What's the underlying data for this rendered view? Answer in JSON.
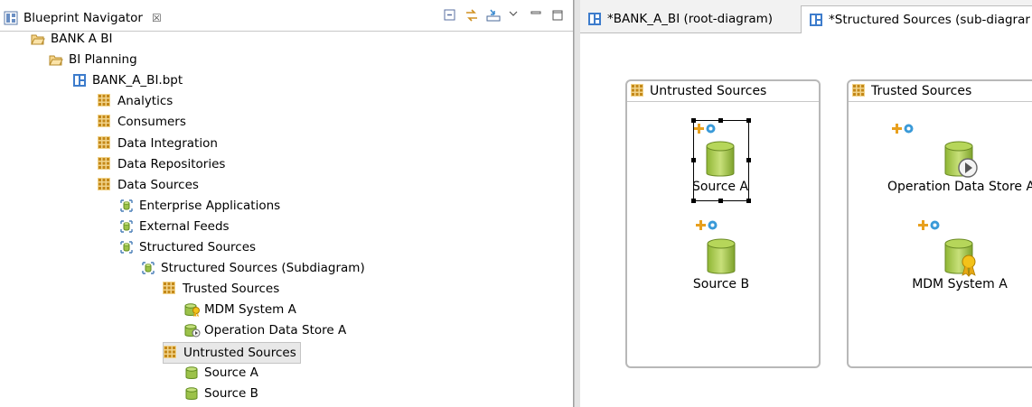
{
  "navigator": {
    "title": "Blueprint Navigator",
    "close_glyph": "☒",
    "tools": [
      "collapse-all-icon",
      "link-with-editor-icon",
      "import-icon",
      "view-menu-icon",
      "minimize-icon",
      "maximize-icon"
    ],
    "tree": [
      {
        "label": "BANK A BI",
        "icon": "folder-open-icon",
        "level": 0
      },
      {
        "label": "BI Planning",
        "icon": "folder-open-icon",
        "level": 1
      },
      {
        "label": "BANK_A_BI.bpt",
        "icon": "blueprint-file-icon",
        "level": 2
      },
      {
        "label": "Analytics",
        "icon": "grid-icon",
        "level": 3
      },
      {
        "label": "Consumers",
        "icon": "grid-icon",
        "level": 3
      },
      {
        "label": "Data Integration",
        "icon": "grid-icon",
        "level": 3
      },
      {
        "label": "Data Repositories",
        "icon": "grid-icon",
        "level": 3
      },
      {
        "label": "Data Sources",
        "icon": "grid-icon",
        "level": 3
      },
      {
        "label": "Enterprise Applications",
        "icon": "subdiagram-icon",
        "level": 4
      },
      {
        "label": "External Feeds",
        "icon": "subdiagram-icon",
        "level": 4
      },
      {
        "label": "Structured Sources",
        "icon": "subdiagram-icon",
        "level": 4
      },
      {
        "label": "Structured Sources (Subdiagram)",
        "icon": "subdiagram-icon",
        "level": 5
      },
      {
        "label": "Trusted Sources",
        "icon": "grid-icon",
        "level": 6
      },
      {
        "label": "MDM System A",
        "icon": "mdm-database-icon",
        "level": 7
      },
      {
        "label": "Operation Data Store A",
        "icon": "ods-database-icon",
        "level": 7
      },
      {
        "label": "Untrusted Sources",
        "icon": "grid-icon",
        "level": 6,
        "selected": true
      },
      {
        "label": "Source A",
        "icon": "database-icon",
        "level": 7
      },
      {
        "label": "Source B",
        "icon": "database-icon",
        "level": 7
      }
    ]
  },
  "editor": {
    "tabs": [
      {
        "label": "*BANK_A_BI (root-diagram)",
        "active": false
      },
      {
        "label": "*Structured Sources (sub-diagrar",
        "active": true
      }
    ],
    "pools": [
      {
        "title": "Untrusted Sources",
        "nodes": [
          {
            "label": "Source A",
            "kind": "database",
            "selected": true
          },
          {
            "label": "Source B",
            "kind": "database",
            "selected": false
          }
        ]
      },
      {
        "title": "Trusted Sources",
        "nodes": [
          {
            "label": "Operation Data Store A",
            "kind": "ods",
            "selected": false
          },
          {
            "label": "MDM System A",
            "kind": "mdm",
            "selected": false
          }
        ]
      }
    ]
  },
  "colors": {
    "accent_blue": "#2a72c4",
    "grid_orange": "#d9a030",
    "db_green": "#8dbf3a",
    "selection": "#e8e8e8"
  }
}
